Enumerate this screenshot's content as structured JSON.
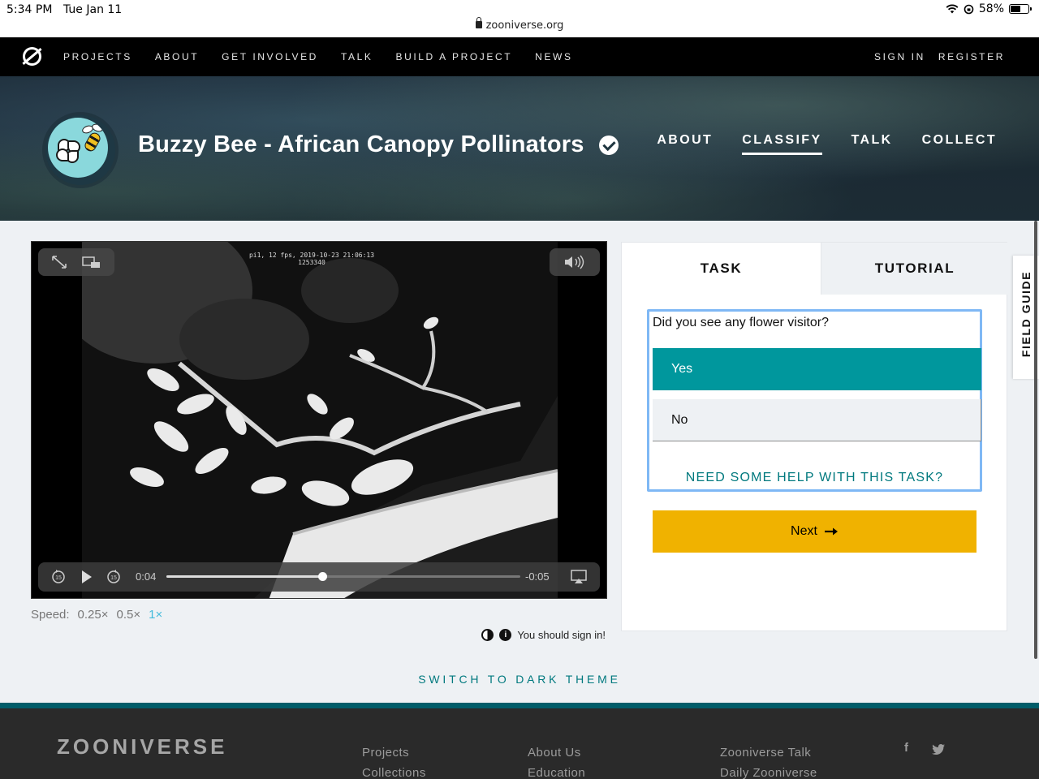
{
  "status_bar": {
    "time": "5:34 PM",
    "date": "Tue Jan 11",
    "url": "zooniverse.org",
    "battery": "58%",
    "battery_level": 0.58
  },
  "top_nav": {
    "links": [
      "PROJECTS",
      "ABOUT",
      "GET INVOLVED",
      "TALK",
      "BUILD A PROJECT",
      "NEWS"
    ],
    "sign_in": "SIGN IN",
    "register": "REGISTER"
  },
  "project": {
    "title": "Buzzy Bee - African Canopy Pollinators",
    "nav": [
      "ABOUT",
      "CLASSIFY",
      "TALK",
      "COLLECT"
    ],
    "active_nav": "CLASSIFY"
  },
  "video": {
    "overlay_line1": "pi1, 12 fps, 2019-10-23 21:06:13",
    "overlay_line2": "1253340",
    "elapsed": "0:04",
    "remaining": "-0:05",
    "progress": 0.44,
    "speed_label": "Speed:",
    "speed_options": [
      "0.25×",
      "0.5×",
      "1×"
    ],
    "selected_speed": "1×"
  },
  "signin_note": "You should sign in!",
  "task_panel": {
    "tabs": [
      "TASK",
      "TUTORIAL"
    ],
    "question": "Did you see any flower visitor?",
    "answers": [
      "Yes",
      "No"
    ],
    "selected_answer": "Yes",
    "help_link": "NEED SOME HELP WITH THIS TASK?",
    "next_label": "Next",
    "colors": {
      "selected": "#00979d",
      "next": "#f0b200",
      "focus_border": "#7fb8f5"
    }
  },
  "field_guide": "FIELD GUIDE",
  "dark_theme_link": "SWITCH TO DARK THEME",
  "footer": {
    "logo": "ZOONIVERSE",
    "col1": [
      "Projects",
      "Collections"
    ],
    "col2": [
      "About Us",
      "Education"
    ],
    "col3": [
      "Zooniverse Talk",
      "Daily Zooniverse"
    ],
    "social_icons": [
      "facebook-icon",
      "twitter-icon"
    ],
    "facebook_glyph": "f",
    "twitter_glyph": "t"
  }
}
